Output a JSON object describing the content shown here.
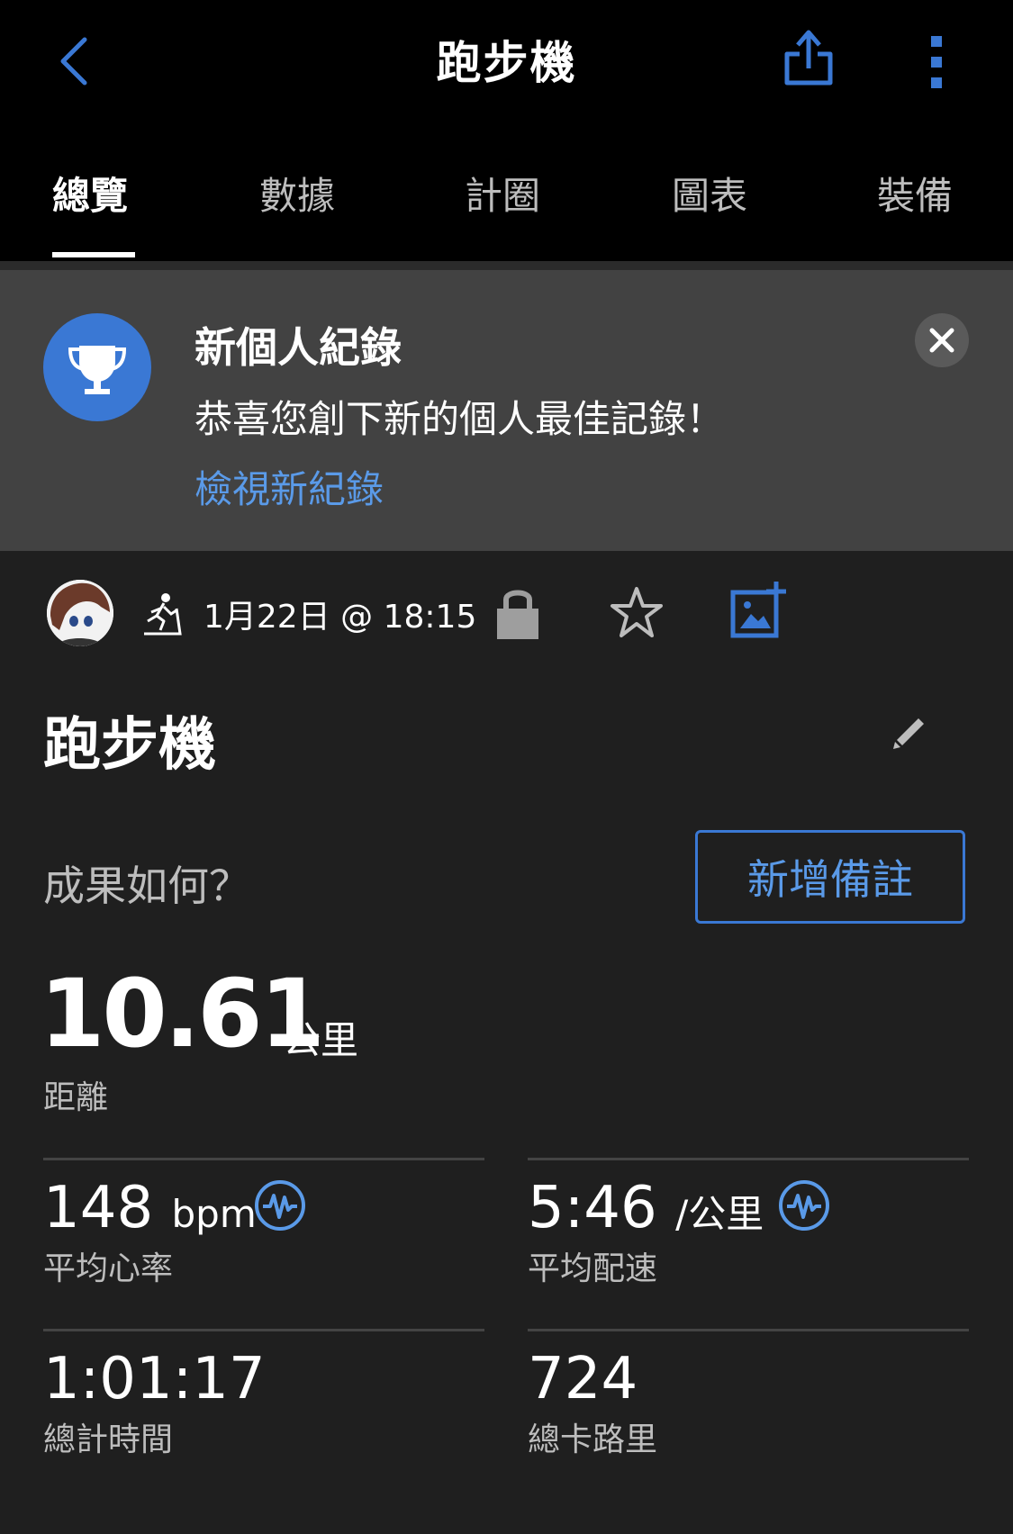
{
  "header": {
    "title": "跑步機",
    "tabs": [
      "總覽",
      "數據",
      "計圈",
      "圖表",
      "裝備"
    ],
    "active_tab": "總覽"
  },
  "banner": {
    "title": "新個人紀錄",
    "text": "恭喜您創下新的個人最佳記錄！",
    "link": "檢視新紀錄"
  },
  "activity_meta": {
    "datetime": "1月22日 @ 18:15",
    "icons": [
      "avatar",
      "treadmill-icon",
      "lock-icon",
      "star-icon",
      "add-photo-icon"
    ]
  },
  "activity": {
    "title": "跑步機",
    "feel_prompt": "成果如何？",
    "add_note_label": "新增備註"
  },
  "distance": {
    "value": "10.61",
    "unit": "公里",
    "label": "距離"
  },
  "stats": {
    "heart_rate": {
      "value": "148",
      "unit": "bpm",
      "label": "平均心率"
    },
    "pace": {
      "value": "5:46",
      "unit": "/公里",
      "label": "平均配速"
    },
    "total_time": {
      "value": "1:01:17",
      "label": "總計時間"
    },
    "calories": {
      "value": "724",
      "label": "總卡路里"
    }
  },
  "colors": {
    "accent": "#3a78d4",
    "link": "#5a9ae8",
    "background": "#1f1f1f",
    "banner": "#424242"
  }
}
